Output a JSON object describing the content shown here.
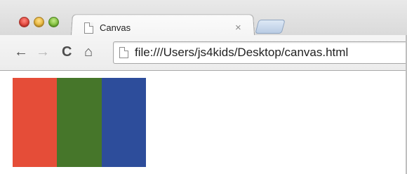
{
  "window": {
    "controls": {
      "close": "#e0443a",
      "minimize": "#e5b43b",
      "zoom": "#7dbd3a"
    }
  },
  "tab": {
    "title": "Canvas",
    "close_glyph": "×",
    "icon": "document-icon"
  },
  "toolbar": {
    "back_glyph": "←",
    "forward_glyph": "→",
    "reload_glyph": "C",
    "home_glyph": "⌂",
    "url": "file:///Users/js4kids/Desktop/canvas.html"
  },
  "canvas": {
    "stripes": [
      {
        "color": "#e54d38"
      },
      {
        "color": "#46762a"
      },
      {
        "color": "#2d4d9b"
      }
    ]
  }
}
